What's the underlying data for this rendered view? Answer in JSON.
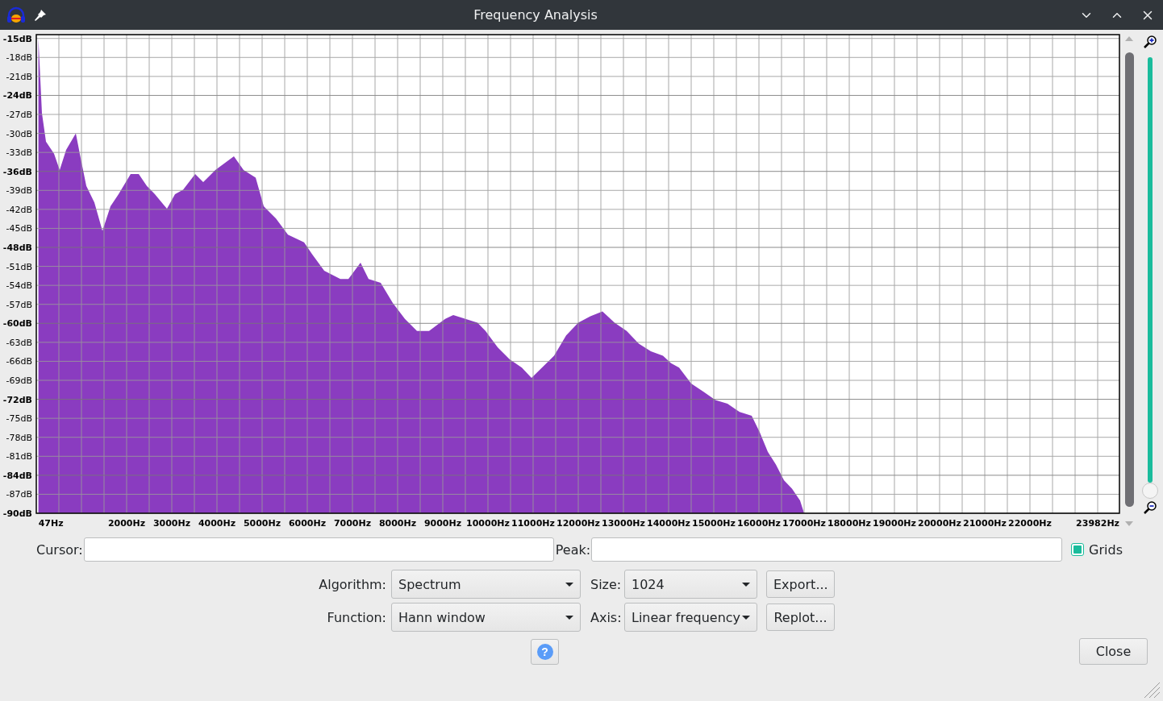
{
  "window": {
    "title": "Frequency Analysis"
  },
  "spectrum": {
    "chart_data": {
      "type": "area",
      "x": [
        47,
        47,
        125,
        214,
        393,
        518,
        661,
        875,
        982,
        1107,
        1286,
        1464,
        1643,
        1821,
        2089,
        2268,
        2446,
        2625,
        2893,
        3071,
        3250,
        3518,
        3696,
        3964,
        4375,
        4589,
        4857,
        5036,
        5304,
        5571,
        5929,
        6107,
        6375,
        6732,
        6911,
        7179,
        7357,
        7625,
        7893,
        8161,
        8429,
        8696,
        9054,
        9232,
        9500,
        9768,
        9946,
        10214,
        10482,
        10750,
        10964,
        11196,
        11464,
        11732,
        12000,
        12268,
        12536,
        12804,
        13071,
        13339,
        13607,
        13875,
        14054,
        14232,
        14500,
        14768,
        15036,
        15304,
        15571,
        15839,
        16018,
        16196,
        16375,
        16554,
        16732,
        16911,
        17000
      ],
      "series": [
        {
          "color": "#8a3cc0",
          "values": [
            -90,
            -15,
            -26.8,
            -31.3,
            -33.2,
            -35.8,
            -32.6,
            -30,
            -33.9,
            -38.3,
            -40.9,
            -45.4,
            -41.5,
            -39.6,
            -36.4,
            -36.4,
            -38.3,
            -39.6,
            -41.9,
            -39.6,
            -38.9,
            -36.4,
            -37.7,
            -35.8,
            -33.6,
            -35.8,
            -37,
            -41.5,
            -43.4,
            -46,
            -47.2,
            -49.1,
            -51.7,
            -53,
            -53,
            -50.4,
            -53,
            -53.6,
            -56.8,
            -59.3,
            -61.2,
            -61.2,
            -59.3,
            -58.7,
            -59.3,
            -59.9,
            -61.2,
            -63.8,
            -65.7,
            -67,
            -68.6,
            -67,
            -65.1,
            -61.9,
            -59.9,
            -58.9,
            -58.1,
            -59.9,
            -61.2,
            -63.2,
            -64.4,
            -65.1,
            -66.3,
            -67,
            -69.5,
            -70.8,
            -72.1,
            -72.7,
            -74,
            -74.6,
            -77.2,
            -80.3,
            -82.3,
            -84.8,
            -86.1,
            -88,
            -90
          ]
        }
      ],
      "xlim": [
        0,
        23982
      ],
      "ylim": [
        -90,
        -14.4
      ],
      "grid": true,
      "xticks": [
        {
          "value": 47,
          "label": "47Hz"
        },
        {
          "value": 2000,
          "label": "2000Hz"
        },
        {
          "value": 3000,
          "label": "3000Hz"
        },
        {
          "value": 4000,
          "label": "4000Hz"
        },
        {
          "value": 5000,
          "label": "5000Hz"
        },
        {
          "value": 6000,
          "label": "6000Hz"
        },
        {
          "value": 7000,
          "label": "7000Hz"
        },
        {
          "value": 8000,
          "label": "8000Hz"
        },
        {
          "value": 9000,
          "label": "9000Hz"
        },
        {
          "value": 10000,
          "label": "10000Hz"
        },
        {
          "value": 11000,
          "label": "11000Hz"
        },
        {
          "value": 12000,
          "label": "12000Hz"
        },
        {
          "value": 13000,
          "label": "13000Hz"
        },
        {
          "value": 14000,
          "label": "14000Hz"
        },
        {
          "value": 15000,
          "label": "15000Hz"
        },
        {
          "value": 16000,
          "label": "16000Hz"
        },
        {
          "value": 17000,
          "label": "17000Hz"
        },
        {
          "value": 18000,
          "label": "18000Hz"
        },
        {
          "value": 19000,
          "label": "19000Hz"
        },
        {
          "value": 20000,
          "label": "20000Hz"
        },
        {
          "value": 21000,
          "label": "21000Hz"
        },
        {
          "value": 22000,
          "label": "22000Hz"
        },
        {
          "value": 23982,
          "label": "23982Hz"
        }
      ],
      "yticks": [
        {
          "value": -15,
          "label": "-15dB"
        },
        {
          "value": -18,
          "label": "-18dB"
        },
        {
          "value": -21,
          "label": "-21dB"
        },
        {
          "value": -24,
          "label": "-24dB"
        },
        {
          "value": -27,
          "label": "-27dB"
        },
        {
          "value": -30,
          "label": "-30dB"
        },
        {
          "value": -33,
          "label": "-33dB"
        },
        {
          "value": -36,
          "label": "-36dB"
        },
        {
          "value": -39,
          "label": "-39dB"
        },
        {
          "value": -42,
          "label": "-42dB"
        },
        {
          "value": -45,
          "label": "-45dB"
        },
        {
          "value": -48,
          "label": "-48dB"
        },
        {
          "value": -51,
          "label": "-51dB"
        },
        {
          "value": -54,
          "label": "-54dB"
        },
        {
          "value": -57,
          "label": "-57dB"
        },
        {
          "value": -60,
          "label": "-60dB"
        },
        {
          "value": -63,
          "label": "-63dB"
        },
        {
          "value": -66,
          "label": "-66dB"
        },
        {
          "value": -69,
          "label": "-69dB"
        },
        {
          "value": -72,
          "label": "-72dB"
        },
        {
          "value": -75,
          "label": "-75dB"
        },
        {
          "value": -78,
          "label": "-78dB"
        },
        {
          "value": -81,
          "label": "-81dB"
        },
        {
          "value": -84,
          "label": "-84dB"
        },
        {
          "value": -87,
          "label": "-87dB"
        },
        {
          "value": -90,
          "label": "-90dB"
        }
      ]
    }
  },
  "zoom_slider": {
    "level": 0
  },
  "readouts": {
    "cursor_label": "Cursor:",
    "peak_label": "Peak:"
  },
  "grids": {
    "label": "Grids",
    "checked": true
  },
  "settings": [
    {
      "label": "Algorithm:",
      "value": "Spectrum",
      "label2": "Size:",
      "value2": "1024",
      "button": "Export..."
    },
    {
      "label": "Function:",
      "value": "Hann window",
      "label2": "Axis:",
      "value2": "Linear frequency",
      "button": "Replot..."
    }
  ],
  "help_button": {
    "label": "?"
  },
  "close_button": {
    "label": "Close"
  }
}
